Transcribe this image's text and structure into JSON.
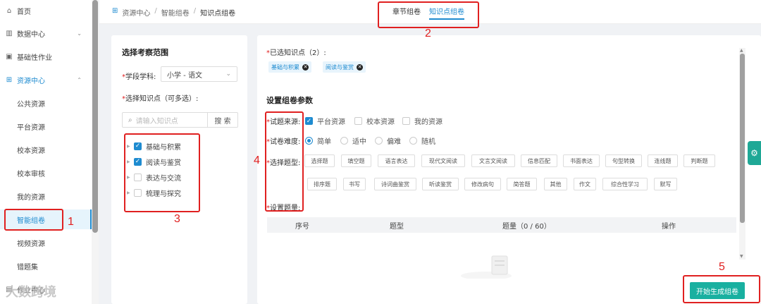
{
  "sidebar": {
    "items": [
      {
        "label": "首页",
        "icon": "home-icon",
        "glyph": "⌂"
      },
      {
        "label": "数据中心",
        "icon": "chart-icon",
        "glyph": "▥"
      },
      {
        "label": "基础性作业",
        "icon": "copy-icon",
        "glyph": "▣"
      },
      {
        "label": "资源中心",
        "icon": "grid-icon",
        "glyph": "⊞"
      }
    ],
    "subitems": [
      "公共资源",
      "平台资源",
      "校本资源",
      "校本审核",
      "我的资源",
      "智能组卷",
      "视频资源",
      "错题集"
    ],
    "bottom_label": "作业中心"
  },
  "breadcrumb": [
    "资源中心",
    "智能组卷",
    "知识点组卷"
  ],
  "tabs": [
    "章节组卷",
    "知识点组卷"
  ],
  "left_panel": {
    "title": "选择考察范围",
    "subject_label": "学段学科:",
    "subject_value": "小学 - 语文",
    "knowledge_label": "选择知识点（可多选）:",
    "search_placeholder": "请输入知识点",
    "search_button": "搜 索",
    "tree": [
      {
        "label": "基础与积累",
        "checked": true
      },
      {
        "label": "阅读与鉴赏",
        "checked": true
      },
      {
        "label": "表达与交流",
        "checked": false
      },
      {
        "label": "梳理与探究",
        "checked": false
      }
    ]
  },
  "right_panel": {
    "selected_label": "已选知识点（2）:",
    "chips": [
      "基础与积累",
      "阅读与鉴赏"
    ],
    "params_title": "设置组卷参数",
    "source_label": "试题来源:",
    "sources": [
      {
        "label": "平台资源",
        "checked": true
      },
      {
        "label": "校本资源",
        "checked": false
      },
      {
        "label": "我的资源",
        "checked": false
      }
    ],
    "difficulty_label": "试卷难度:",
    "difficulties": [
      {
        "label": "简单",
        "checked": true
      },
      {
        "label": "适中",
        "checked": false
      },
      {
        "label": "偏难",
        "checked": false
      },
      {
        "label": "随机",
        "checked": false
      }
    ],
    "qtype_label": "选择题型:",
    "qtypes_row1": [
      "选择题",
      "填空题",
      "语言表达",
      "现代文阅读",
      "文言文阅读",
      "信息匹配",
      "书面表达",
      "句型转换",
      "连线题",
      "判断题"
    ],
    "qtypes_row2": [
      "排序题",
      "书写",
      "诗词曲鉴赏",
      "听读鉴赏",
      "修改病句",
      "简答题",
      "其他",
      "作文",
      "综合性学习",
      "默写"
    ],
    "count_label": "设置题量:",
    "table_headers": [
      "序号",
      "题型",
      "题量（0 / 60）",
      "操作"
    ],
    "generate_button": "开始生成组卷"
  },
  "annotations": [
    "1",
    "2",
    "3",
    "4",
    "5"
  ],
  "watermark": "大数跨境",
  "colors": {
    "accent": "#1e8bd0",
    "generate": "#19b0a0",
    "annotation": "#e02020"
  }
}
